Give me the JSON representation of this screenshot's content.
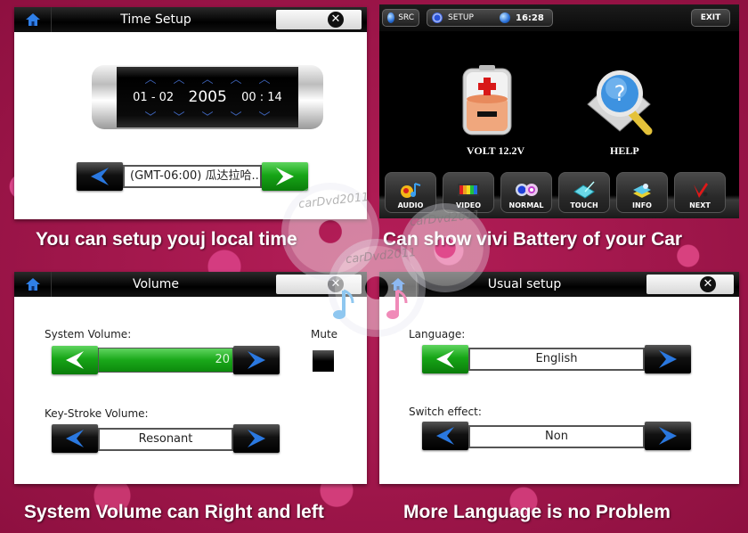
{
  "colors": {
    "background": "#a31650",
    "titlebar": "#000000",
    "green_button": "#17a517",
    "arrow_blue": "#2a78e0",
    "dialog_bg": "#ffffff"
  },
  "watermark": "carDvd2011",
  "time_setup": {
    "title": "Time Setup",
    "home_icon": "home-icon",
    "close_icon": "close-icon",
    "date_month_day": "01 - 02",
    "year": "2005",
    "time": "00 : 14",
    "timezone": "(GMT-06:00) 瓜达拉哈...",
    "caption": "You can setup youj local time"
  },
  "car_setup": {
    "src_label": "SRC",
    "setup_label": "SETUP",
    "clock": "16:28",
    "exit_label": "EXIT",
    "battery_label": "VOLT 12.2V",
    "help_label": "HELP",
    "dock": [
      {
        "label": "AUDIO",
        "icon": "audio-icon"
      },
      {
        "label": "VIDEO",
        "icon": "video-icon"
      },
      {
        "label": "NORMAL",
        "icon": "gears-icon"
      },
      {
        "label": "TOUCH",
        "icon": "touch-pen-icon"
      },
      {
        "label": "INFO",
        "icon": "info-icon"
      },
      {
        "label": "NEXT",
        "icon": "next-icon"
      }
    ],
    "caption": "Can show vivi Battery of your Car"
  },
  "volume": {
    "title": "Volume",
    "system_volume_label": "System Volume:",
    "system_volume_value": "20",
    "mute_label": "Mute",
    "keystroke_label": "Key-Stroke Volume:",
    "keystroke_value": "Resonant",
    "caption": "System Volume can Right and left"
  },
  "usual_setup": {
    "title": "Usual setup",
    "language_label": "Language:",
    "language_value": "English",
    "switch_effect_label": "Switch effect:",
    "switch_effect_value": "Non",
    "caption": "More Language is no Problem"
  }
}
